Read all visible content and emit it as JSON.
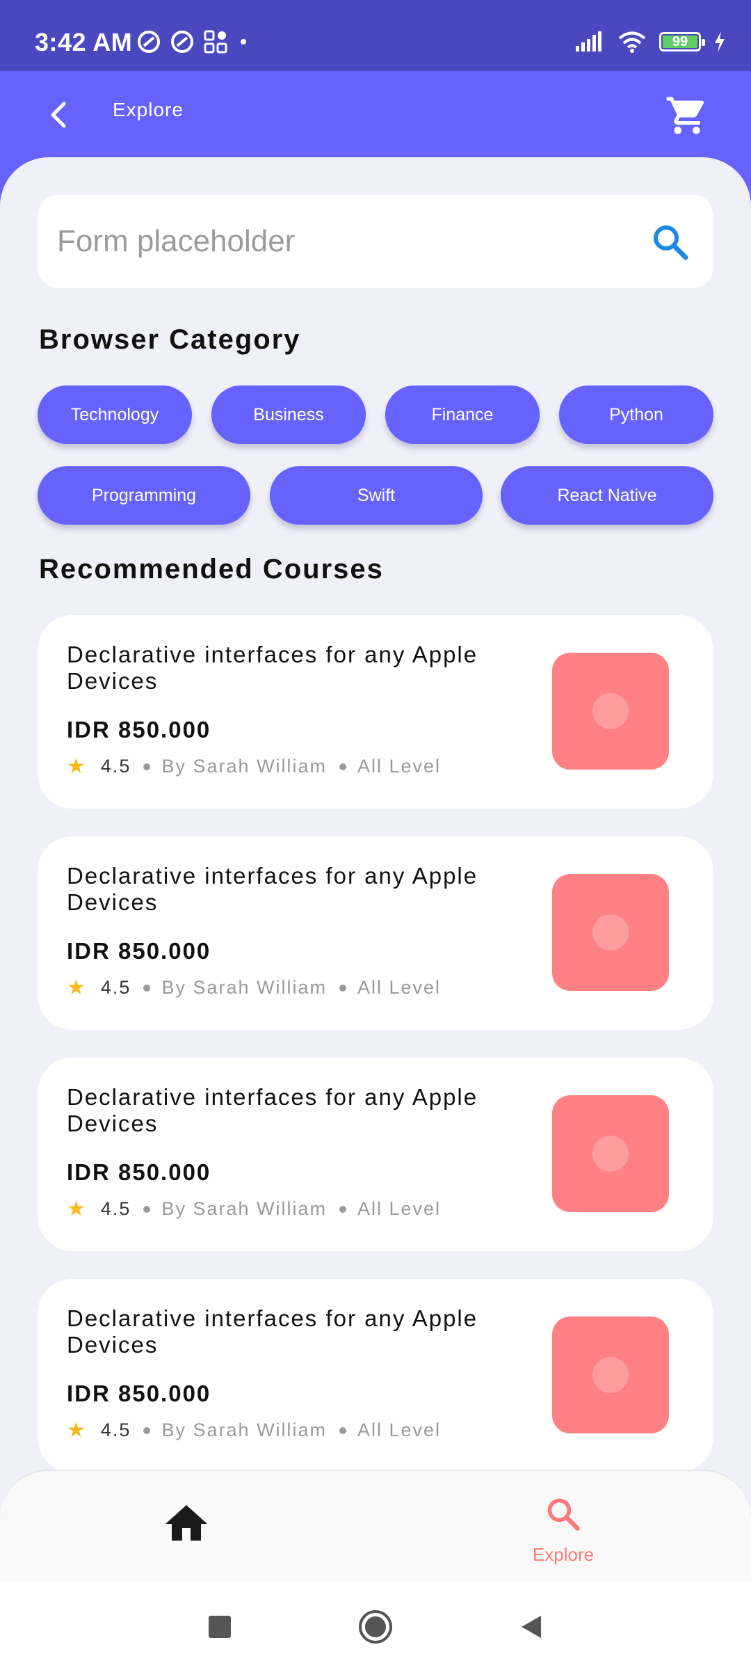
{
  "status_bar": {
    "time": "3:42 AM",
    "battery": "99"
  },
  "app_bar": {
    "title": "Explore"
  },
  "search": {
    "placeholder": "Form placeholder"
  },
  "sections": {
    "browse_title": "Browser Category",
    "recommended_title": "Recommended Courses"
  },
  "categories": [
    "Technology",
    "Business",
    "Finance",
    "Python",
    "Programming",
    "Swift",
    "React Native"
  ],
  "courses": [
    {
      "title": "Declarative interfaces for any Apple Devices",
      "price": "IDR 850.000",
      "rating": "4.5",
      "author": "By Sarah William",
      "level": "All Level"
    },
    {
      "title": "Declarative interfaces for any Apple Devices",
      "price": "IDR 850.000",
      "rating": "4.5",
      "author": "By Sarah William",
      "level": "All Level"
    },
    {
      "title": "Declarative interfaces for any Apple Devices",
      "price": "IDR 850.000",
      "rating": "4.5",
      "author": "By Sarah William",
      "level": "All Level"
    },
    {
      "title": "Declarative interfaces for any Apple Devices",
      "price": "IDR 850.000",
      "rating": "4.5",
      "author": "By Sarah William",
      "level": "All Level"
    }
  ],
  "bottom_nav": {
    "explore_label": "Explore"
  },
  "colors": {
    "primary": "#6563fb",
    "status_bar": "#4a48be",
    "background": "#f0f0f8",
    "thumbnail": "#ff8183",
    "accent_active": "#ff7a7a",
    "star": "#f8b91c",
    "search_icon": "#1e88e5"
  }
}
